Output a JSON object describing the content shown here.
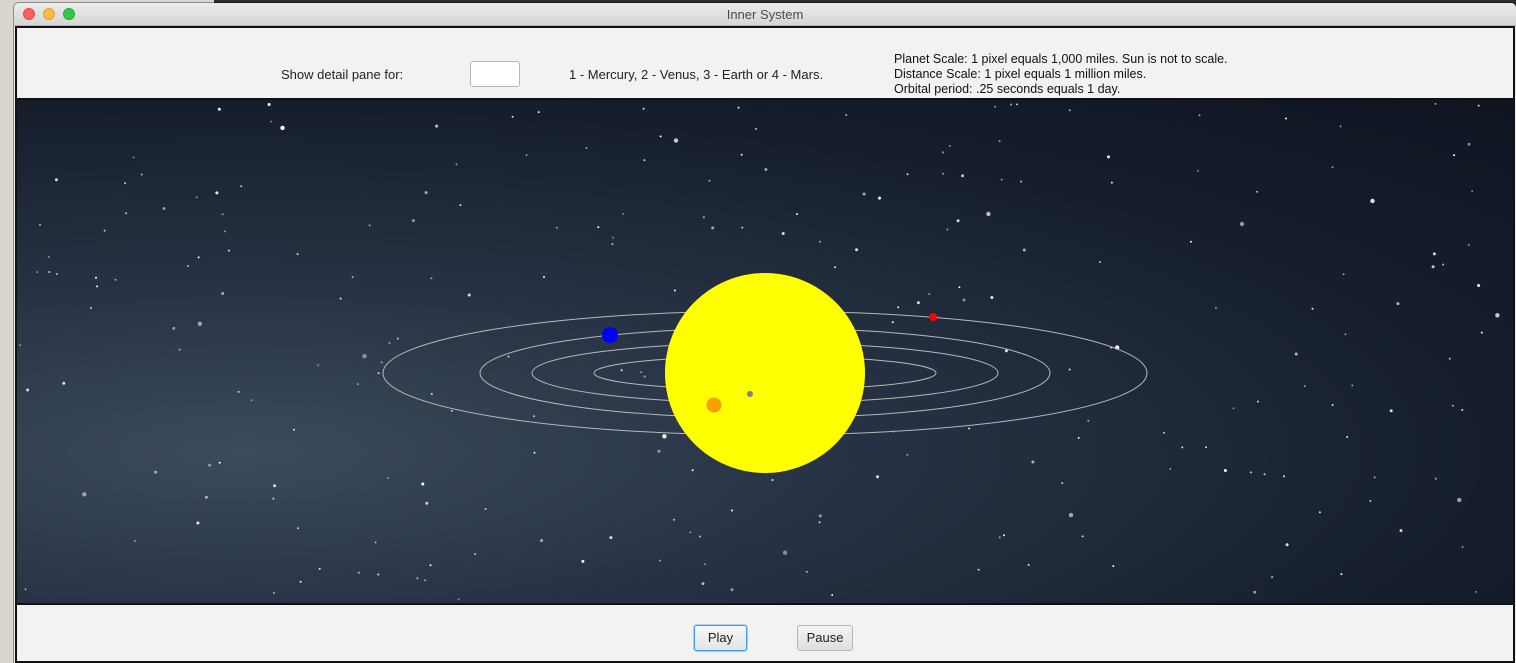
{
  "window": {
    "title": "Inner System"
  },
  "controls": {
    "detail_label": "Show detail pane for:",
    "detail_input_value": "",
    "planet_hint": "1 - Mercury, 2 - Venus, 3 - Earth or 4 - Mars.",
    "scale_info": [
      "Planet Scale:  1 pixel equals 1,000 miles.  Sun is not to scale.",
      "Distance Scale:  1 pixel equals 1 million miles.",
      "Orbital period:  .25 seconds equals 1 day."
    ]
  },
  "simulation": {
    "sun_color": "#ffff00",
    "orbit_color": "#b8b8b8",
    "planets": [
      {
        "name": "Mercury",
        "color": "#808080"
      },
      {
        "name": "Venus",
        "color": "#f5a000"
      },
      {
        "name": "Earth",
        "color": "#0000ff"
      },
      {
        "name": "Mars",
        "color": "#ff0000"
      }
    ]
  },
  "buttons": {
    "play_label": "Play",
    "pause_label": "Pause"
  }
}
